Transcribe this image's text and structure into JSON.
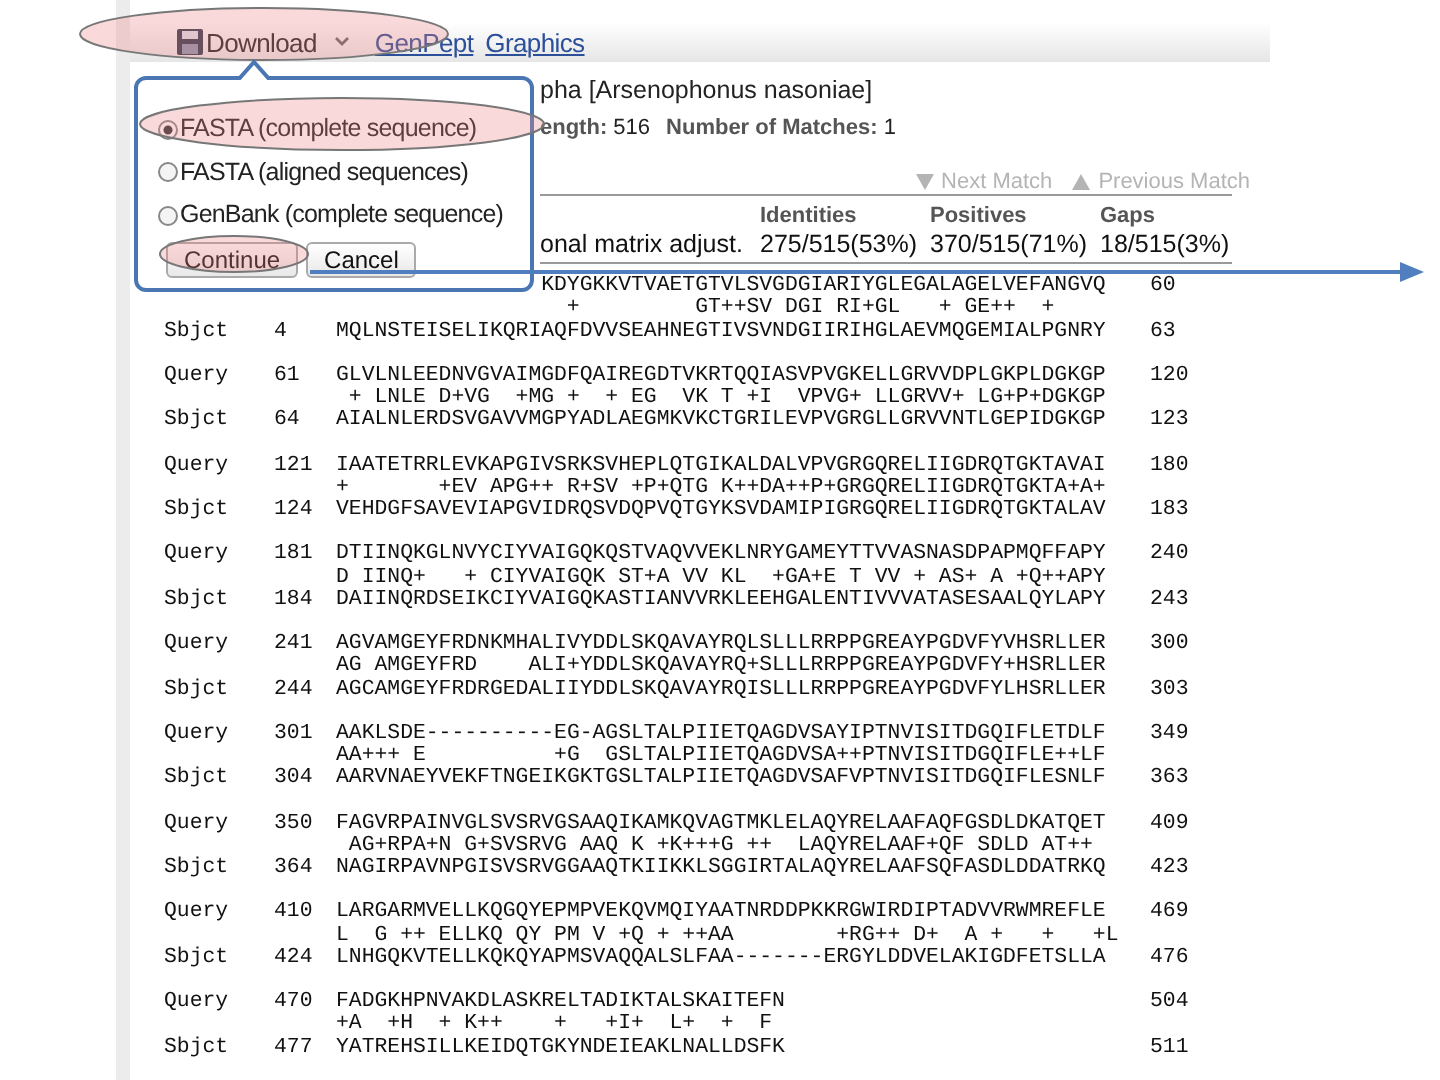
{
  "toolbar": {
    "items": [
      {
        "kind": "menu",
        "label": "Download"
      },
      {
        "kind": "link",
        "label": "GenPept"
      },
      {
        "kind": "link",
        "label": "Graphics"
      }
    ]
  },
  "download_popup": {
    "options": [
      {
        "label": "FASTA (complete sequence)",
        "selected": true
      },
      {
        "label": "FASTA (aligned sequences)",
        "selected": false
      },
      {
        "label": "GenBank (complete sequence)",
        "selected": false
      }
    ],
    "buttons": [
      "Continue",
      "Cancel"
    ]
  },
  "header": {
    "title": "pha [Arsenophonus nasoniae]",
    "length_label": "ength:",
    "length": "516",
    "matches_label": "Number of Matches:",
    "matches": "1"
  },
  "navigation": [
    {
      "kind": "next",
      "label": "Next Match",
      "disabled": true
    },
    {
      "kind": "previous",
      "label": "Previous Match",
      "disabled": true
    }
  ],
  "score_table": {
    "columns": [
      "Identities",
      "Positives",
      "Gaps"
    ],
    "row": [
      "onal matrix adjust.",
      "275/515(53%)",
      "370/515(71%)",
      "18/515(3%)"
    ]
  },
  "alignment": [
    {
      "query": {
        "seq": "KDYGKKVTVAETGTVLSVGDGIARIYGLEGALAGELVEFANGVQ",
        "end": "60"
      },
      "midline": "  +         GT++SV DGI RI+GL   + GE++  +",
      "subject": {
        "label": "Sbjct",
        "start": "4",
        "seq": "MQLNSTEISELIKQRIAQFDVVSEAHNEGTIVSVNDGIIRIHGLAEVMQGEMIALPGNRY",
        "end": "63"
      }
    },
    {
      "query": {
        "label": "Query",
        "start": "61",
        "seq": "GLVLNLEEDNVGVAIMGDFQAIREGDTVKRTQQIASVPVGKELLGRVVDPLGKPLDGKGP",
        "end": "120"
      },
      "midline": " + LNLE D+VG  +MG +  + EG  VK T +I  VPVG+ LLGRVV+ LG+P+DGKGP",
      "subject": {
        "label": "Sbjct",
        "start": "64",
        "seq": "AIALNLERDSVGAVVMGPYADLAEGMKVKCTGRILEVPVGRGLLGRVVNTLGEPIDGKGP",
        "end": "123"
      }
    },
    {
      "query": {
        "label": "Query",
        "start": "121",
        "seq": "IAATETRRLEVKAPGIVSRKSVHEPLQTGIKALDALVPVGRGQRELIIGDRQTGKTAVAI",
        "end": "180"
      },
      "midline": "+       +EV APG++ R+SV +P+QTG K++DA++P+GRGQRELIIGDRQTGKTA+A+",
      "subject": {
        "label": "Sbjct",
        "start": "124",
        "seq": "VEHDGFSAVEVIAPGVIDRQSVDQPVQTGYKSVDAMIPIGRGQRELIIGDRQTGKTALAV",
        "end": "183"
      }
    },
    {
      "query": {
        "label": "Query",
        "start": "181",
        "seq": "DTIINQKGLNVYCIYVAIGQKQSTVAQVVEKLNRYGAMEYTTVVASNASDPAPMQFFAPY",
        "end": "240"
      },
      "midline": "D IINQ+   + CIYVAIGQK ST+A VV KL  +GA+E T VV + AS+ A +Q++APY",
      "subject": {
        "label": "Sbjct",
        "start": "184",
        "seq": "DAIINQRDSEIKCIYVAIGQKASTIANVVRKLEEHGALENTIVVVATASESAALQYLAPY",
        "end": "243"
      }
    },
    {
      "query": {
        "label": "Query",
        "start": "241",
        "seq": "AGVAMGEYFRDNKMHALIVYDDLSKQAVAYRQLSLLLRRPPGREAYPGDVFYVHSRLLER",
        "end": "300"
      },
      "midline": "AG AMGEYFRD    ALI+YDDLSKQAVAYRQ+SLLLRRPPGREAYPGDVFY+HSRLLER",
      "subject": {
        "label": "Sbjct",
        "start": "244",
        "seq": "AGCAMGEYFRDRGEDALIIYDDLSKQAVAYRQISLLLRRPPGREAYPGDVFYLHSRLLER",
        "end": "303"
      }
    },
    {
      "query": {
        "label": "Query",
        "start": "301",
        "seq": "AAKLSDE----------EG-AGSLTALPIIETQAGDVSAYIPTNVISITDGQIFLETDLF",
        "end": "349"
      },
      "midline": "AA+++ E          +G  GSLTALPIIETQAGDVSA++PTNVISITDGQIFLE++LF",
      "subject": {
        "label": "Sbjct",
        "start": "304",
        "seq": "AARVNAEYVEKFTNGEIKGKTGSLTALPIIETQAGDVSAFVPTNVISITDGQIFLESNLF",
        "end": "363"
      }
    },
    {
      "query": {
        "label": "Query",
        "start": "350",
        "seq": "FAGVRPAINVGLSVSRVGSAAQIKAMKQVAGTMKLELAQYRELAAFAQFGSDLDKATQET",
        "end": "409"
      },
      "midline": " AG+RPA+N G+SVSRVG AAQ K +K+++G ++  LAQYRELAAF+QF SDLD AT++",
      "subject": {
        "label": "Sbjct",
        "start": "364",
        "seq": "NAGIRPAVNPGISVSRVGGAAQTKIIKKLSGGIRTALAQYRELAAFSQFASDLDDATRKQ",
        "end": "423"
      }
    },
    {
      "query": {
        "label": "Query",
        "start": "410",
        "seq": "LARGARMVELLKQGQYEPMPVEKQVMQIYAATNRDDPKKRGWIRDIPTADVVRWMREFLE",
        "end": "469"
      },
      "midline": "L  G ++ ELLKQ QY PM V +Q + ++AA        +RG++ D+  A +   +   +L",
      "subject": {
        "label": "Sbjct",
        "start": "424",
        "seq": "LNHGQKVTELLKQKQYAPMSVAQQALSLFAA-------ERGYLDDVELAKIGDFETSLLA",
        "end": "476"
      }
    },
    {
      "query": {
        "label": "Query",
        "start": "470",
        "seq": "FADGKHPNVAKDLASKRELTADIKTALSKAITEFN",
        "end": "504"
      },
      "midline": "+A  +H  + K++    +   +I+  L+  +  F",
      "subject": {
        "label": "Sbjct",
        "start": "477",
        "seq": "YATREHSILLKEIDQTGKYNDEIEAKLNALLDSFK",
        "end": "511"
      }
    }
  ]
}
